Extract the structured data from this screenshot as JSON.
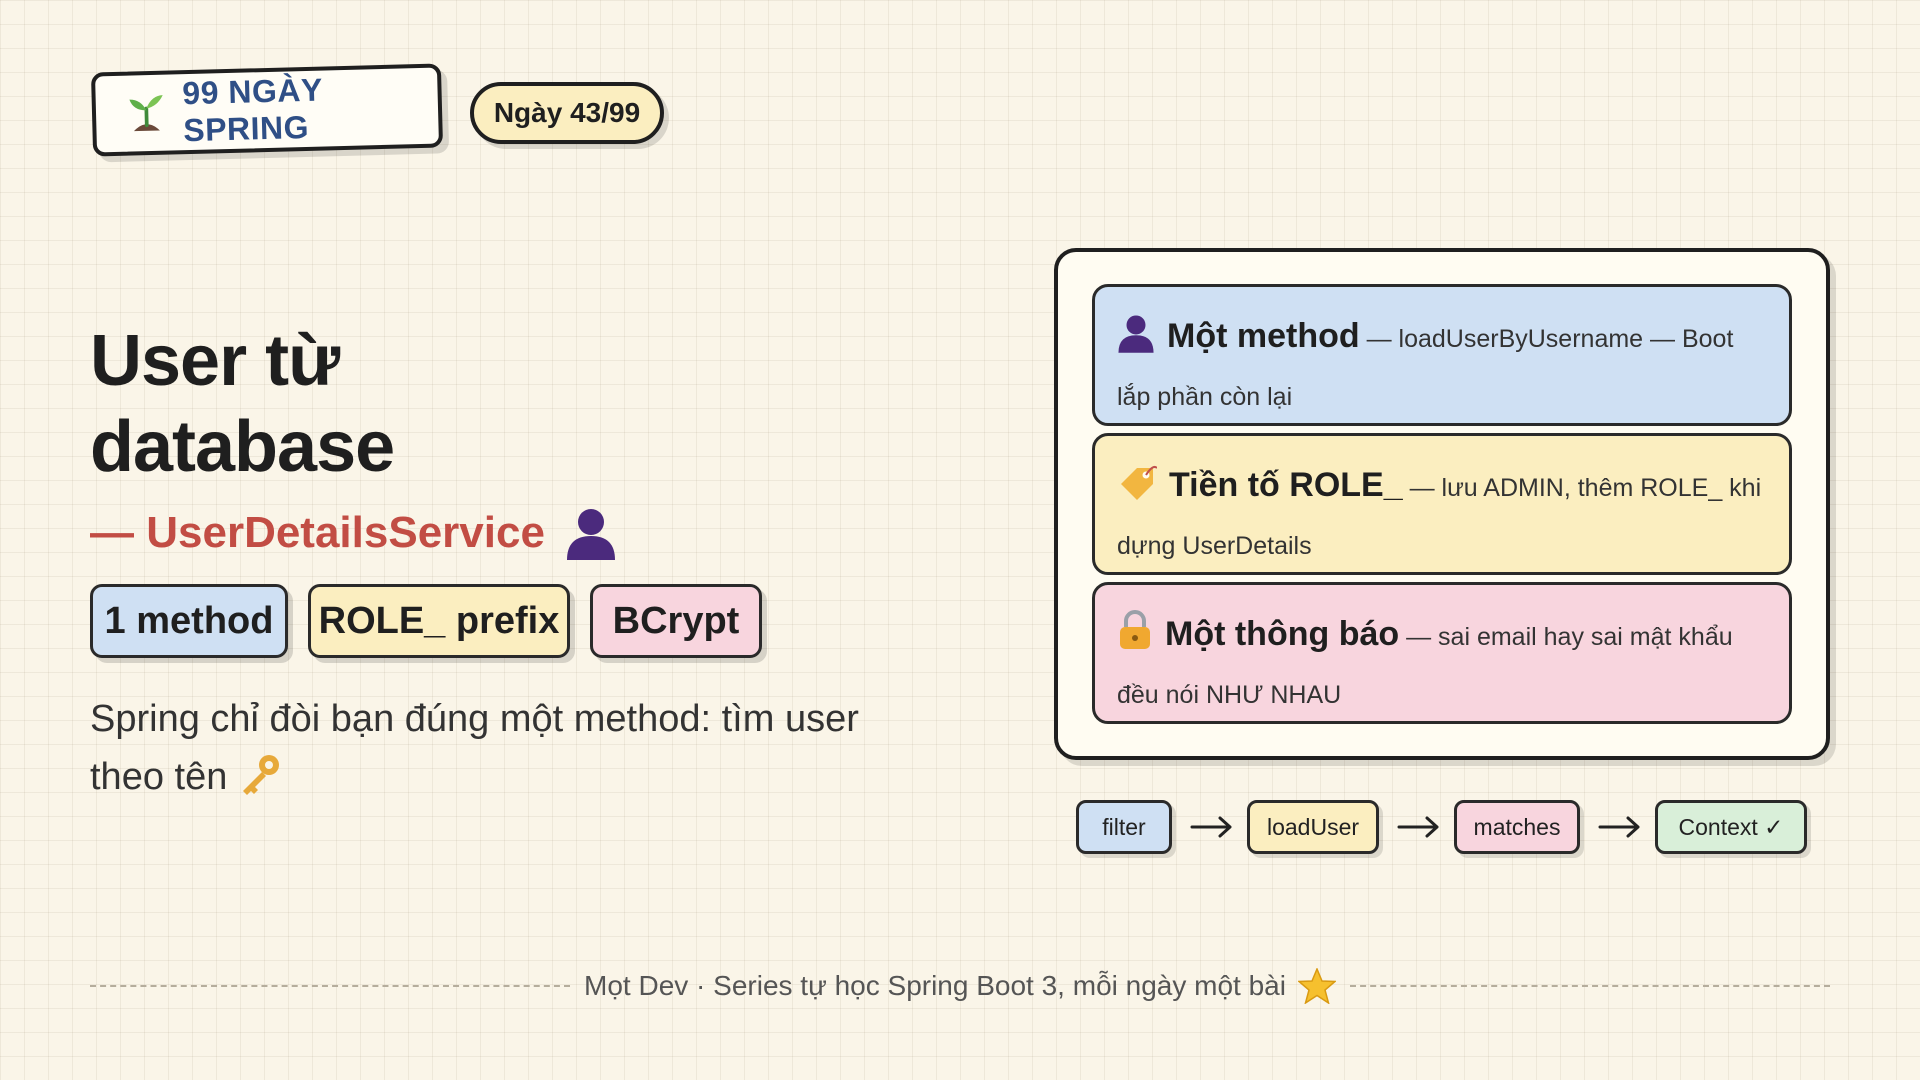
{
  "header": {
    "series_badge": "99 NGÀY SPRING",
    "day_pill": "Ngày 43/99"
  },
  "title": {
    "line1": "User từ",
    "line2": "database",
    "subtitle": "— UserDetailsService"
  },
  "tags": [
    "1 method",
    "ROLE_ prefix",
    "BCrypt"
  ],
  "description": "Spring chỉ đòi bạn đúng một method: tìm user theo tên",
  "cards": [
    {
      "head": "Một method",
      "body": " — loadUserByUsername — Boot lắp phần còn lại"
    },
    {
      "head": "Tiền tố ROLE_",
      "body": " — lưu ADMIN, thêm ROLE_ khi dựng UserDetails"
    },
    {
      "head": "Một thông báo",
      "body": " — sai email hay sai mật khẩu đều nói NHƯ NHAU"
    }
  ],
  "flow": [
    "filter",
    "loadUser",
    "matches",
    "Context ✓"
  ],
  "footer": {
    "text": "Mọt Dev · Series tự học Spring Boot 3, mỗi ngày một bài"
  },
  "icons": {
    "series": "sprout-icon",
    "subtitle": "person-icon",
    "description": "key-icon",
    "cards": [
      "person-icon",
      "tag-icon",
      "lock-icon"
    ],
    "footer": "star-icon"
  },
  "colors": {
    "blue": "#cfe0f3",
    "yellow": "#fbeec0",
    "pink": "#f8d5de",
    "green": "#d9efd9",
    "accent_red": "#c24d44",
    "badge_blue": "#2f4f86"
  }
}
